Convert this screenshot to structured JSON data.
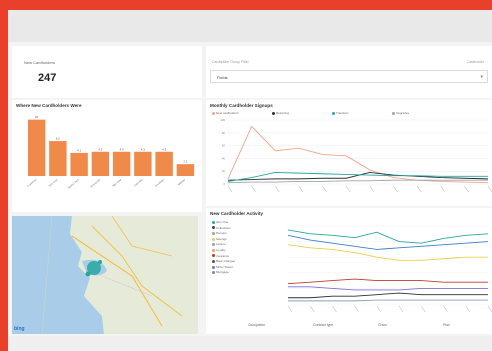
{
  "kpi": {
    "label": "New Cardholders",
    "value": "247"
  },
  "filter": {
    "label": "Cardholder Group Filter",
    "right_label": "Cardholder",
    "selected": "Fields"
  },
  "bar_chart": {
    "title": "Where New Cardholders Were",
    "color": "#f08a4b",
    "chart_data": {
      "type": "bar",
      "categories": [
        "Cupertino",
        "San Jose",
        "Santa Clara",
        "Sunnyvale",
        "Mtn View",
        "Palo Alto",
        "Saratoga",
        "Milpitas"
      ],
      "values": [
        10,
        6.2,
        4.1,
        4.3,
        4.3,
        4.3,
        4.3,
        2.1
      ],
      "ylim": [
        0,
        11
      ]
    }
  },
  "line_chart": {
    "title": "Monthly Cardholder Signups",
    "legend": [
      {
        "name": "New cardholders",
        "color": "#f2a58a"
      },
      {
        "name": "Returning",
        "color": "#2a2f36"
      },
      {
        "name": "Transfers",
        "color": "#27a7a0"
      },
      {
        "name": "Upgrades",
        "color": "#9aa4b0"
      }
    ],
    "chart_data": {
      "type": "line",
      "ylim": [
        0,
        100
      ],
      "y_ticks": [
        "100",
        "80",
        "60",
        "40",
        "20",
        "0"
      ],
      "series": [
        {
          "values": [
            8,
            90,
            52,
            56,
            46,
            44,
            22,
            10,
            6,
            4,
            3,
            2
          ]
        },
        {
          "values": [
            6,
            7,
            8,
            8,
            9,
            9,
            18,
            14,
            12,
            10,
            9,
            8
          ]
        },
        {
          "values": [
            4,
            10,
            18,
            17,
            16,
            15,
            14,
            13,
            13,
            12,
            12,
            12
          ]
        },
        {
          "values": [
            2,
            3,
            3,
            4,
            4,
            5,
            5,
            6,
            6,
            6,
            6,
            6
          ]
        }
      ]
    }
  },
  "activity_chart": {
    "title": "New Cardholder Activity",
    "legend": [
      {
        "name": "Item One",
        "color": "#27a7a0"
      },
      {
        "name": "Collections",
        "color": "#3b4a5a"
      },
      {
        "name": "Pension",
        "color": "#9aa4b0"
      },
      {
        "name": "Savings",
        "color": "#e8d04a"
      },
      {
        "name": "Leisure",
        "color": "#8aa1b8"
      },
      {
        "name": "Loyalty",
        "color": "#f2a35a"
      },
      {
        "name": "Insurance",
        "color": "#c0392b"
      },
      {
        "name": "Bank Charges",
        "color": "#555555"
      },
      {
        "name": "Motor Travel",
        "color": "#7c6fd1"
      },
      {
        "name": "Mortgage",
        "color": "#6a8caf"
      }
    ],
    "x_categories": [
      "Occupation",
      "Contract type",
      "Churn",
      "Plan"
    ],
    "chart_data": {
      "type": "line",
      "ylim": [
        0,
        100
      ],
      "series": [
        {
          "values": [
            95,
            90,
            88,
            85,
            92,
            80,
            78,
            84,
            88,
            90
          ]
        },
        {
          "values": [
            88,
            82,
            78,
            74,
            70,
            72,
            74,
            76,
            78,
            80
          ]
        },
        {
          "values": [
            76,
            72,
            70,
            66,
            60,
            56,
            56,
            58,
            60,
            60
          ]
        },
        {
          "values": [
            26,
            28,
            30,
            32,
            30,
            30,
            30,
            28,
            28,
            28
          ]
        },
        {
          "values": [
            22,
            22,
            20,
            18,
            18,
            18,
            20,
            20,
            20,
            20
          ]
        },
        {
          "values": [
            8,
            8,
            10,
            10,
            12,
            14,
            12,
            12,
            12,
            12
          ]
        },
        {
          "values": [
            4,
            4,
            4,
            4,
            5,
            5,
            5,
            5,
            5,
            5
          ]
        }
      ]
    }
  },
  "map": {
    "attribution": "bing"
  }
}
